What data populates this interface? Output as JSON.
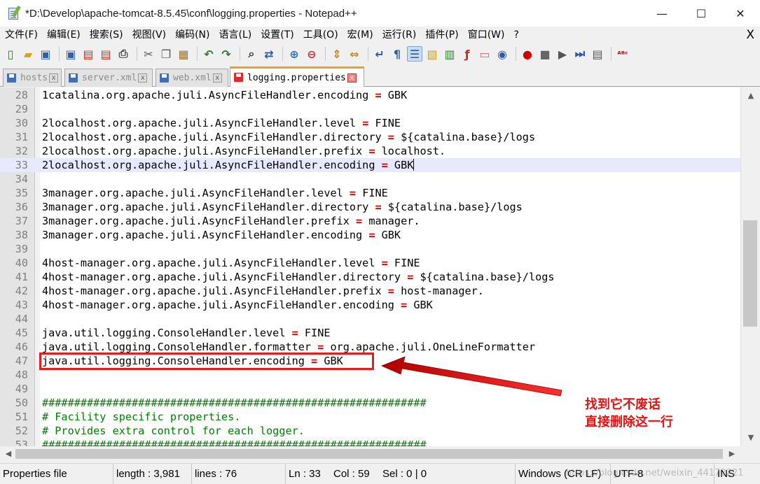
{
  "window": {
    "title": "*D:\\Develop\\apache-tomcat-8.5.45\\conf\\logging.properties - Notepad++",
    "minimize": "—",
    "maximize": "☐",
    "close": "✕"
  },
  "menu": {
    "items": [
      "文件(F)",
      "编辑(E)",
      "搜索(S)",
      "视图(V)",
      "编码(N)",
      "语言(L)",
      "设置(T)",
      "工具(O)",
      "宏(M)",
      "运行(R)",
      "插件(P)",
      "窗口(W)",
      "?"
    ],
    "close": "X"
  },
  "toolbar": {
    "icons": [
      "new-file-icon",
      "open-file-icon",
      "save-icon",
      "save-all-icon",
      "close-icon",
      "close-all-icon",
      "print-icon",
      "cut-icon",
      "copy-icon",
      "paste-icon",
      "undo-icon",
      "redo-icon",
      "find-icon",
      "replace-icon",
      "zoom-in-icon",
      "zoom-out-icon",
      "sync-vertical-icon",
      "sync-horizontal-icon",
      "word-wrap-icon",
      "show-all-chars-icon",
      "indent-guide-icon",
      "udl-icon",
      "doc-map-icon",
      "function-list-icon",
      "folder-workspace-icon",
      "monitor-icon",
      "record-macro-icon",
      "stop-macro-icon",
      "play-macro-icon",
      "run-macro-multiple-icon",
      "save-macro-icon",
      "spell-check-icon"
    ]
  },
  "tabs": [
    {
      "label": "hosts",
      "active": false
    },
    {
      "label": "server.xml",
      "active": false
    },
    {
      "label": "web.xml",
      "active": false
    },
    {
      "label": "logging.properties",
      "active": true
    }
  ],
  "editor": {
    "lines": [
      {
        "n": "28",
        "key": "1catalina.org.apache.juli.AsyncFileHandler.encoding",
        "value": "GBK",
        "kind": "prop"
      },
      {
        "n": "29",
        "kind": "blank"
      },
      {
        "n": "30",
        "key": "2localhost.org.apache.juli.AsyncFileHandler.level",
        "value": "FINE",
        "kind": "prop"
      },
      {
        "n": "31",
        "key": "2localhost.org.apache.juli.AsyncFileHandler.directory",
        "value": "${catalina.base}/logs",
        "kind": "prop"
      },
      {
        "n": "32",
        "key": "2localhost.org.apache.juli.AsyncFileHandler.prefix",
        "value": "localhost.",
        "kind": "prop"
      },
      {
        "n": "33",
        "key": "2localhost.org.apache.juli.AsyncFileHandler.encoding",
        "value": "GBK",
        "kind": "prop",
        "current": true
      },
      {
        "n": "34",
        "kind": "blank"
      },
      {
        "n": "35",
        "key": "3manager.org.apache.juli.AsyncFileHandler.level",
        "value": "FINE",
        "kind": "prop"
      },
      {
        "n": "36",
        "key": "3manager.org.apache.juli.AsyncFileHandler.directory",
        "value": "${catalina.base}/logs",
        "kind": "prop"
      },
      {
        "n": "37",
        "key": "3manager.org.apache.juli.AsyncFileHandler.prefix",
        "value": "manager.",
        "kind": "prop"
      },
      {
        "n": "38",
        "key": "3manager.org.apache.juli.AsyncFileHandler.encoding",
        "value": "GBK",
        "kind": "prop"
      },
      {
        "n": "39",
        "kind": "blank"
      },
      {
        "n": "40",
        "key": "4host-manager.org.apache.juli.AsyncFileHandler.level",
        "value": "FINE",
        "kind": "prop"
      },
      {
        "n": "41",
        "key": "4host-manager.org.apache.juli.AsyncFileHandler.directory",
        "value": "${catalina.base}/logs",
        "kind": "prop"
      },
      {
        "n": "42",
        "key": "4host-manager.org.apache.juli.AsyncFileHandler.prefix",
        "value": "host-manager.",
        "kind": "prop"
      },
      {
        "n": "43",
        "key": "4host-manager.org.apache.juli.AsyncFileHandler.encoding",
        "value": "GBK",
        "kind": "prop"
      },
      {
        "n": "44",
        "kind": "blank"
      },
      {
        "n": "45",
        "key": "java.util.logging.ConsoleHandler.level",
        "value": "FINE",
        "kind": "prop"
      },
      {
        "n": "46",
        "key": "java.util.logging.ConsoleHandler.formatter",
        "value": "org.apache.juli.OneLineFormatter",
        "kind": "prop"
      },
      {
        "n": "47",
        "key": "java.util.logging.ConsoleHandler.encoding",
        "value": "GBK",
        "kind": "prop"
      },
      {
        "n": "48",
        "kind": "blank"
      },
      {
        "n": "49",
        "kind": "blank"
      },
      {
        "n": "50",
        "text": "############################################################",
        "kind": "comment"
      },
      {
        "n": "51",
        "text": "# Facility specific properties.",
        "kind": "comment"
      },
      {
        "n": "52",
        "text": "# Provides extra control for each logger.",
        "kind": "comment"
      },
      {
        "n": "53",
        "text": "############################################################",
        "kind": "comment"
      }
    ],
    "operator": "="
  },
  "annotation": {
    "line1": "找到它不废话",
    "line2": "直接删除这一行",
    "color": "#e81010"
  },
  "status": {
    "file_type": "Properties file",
    "length": "length : 3,981",
    "lines": "lines : 76",
    "ln": "Ln : 33",
    "col": "Col : 59",
    "sel": "Sel : 0 | 0",
    "eol": "Windows (CR LF)",
    "encoding": "UTF-8",
    "mode": "INS"
  },
  "watermark": "https://blog.csdn.net/weixin_44172221"
}
